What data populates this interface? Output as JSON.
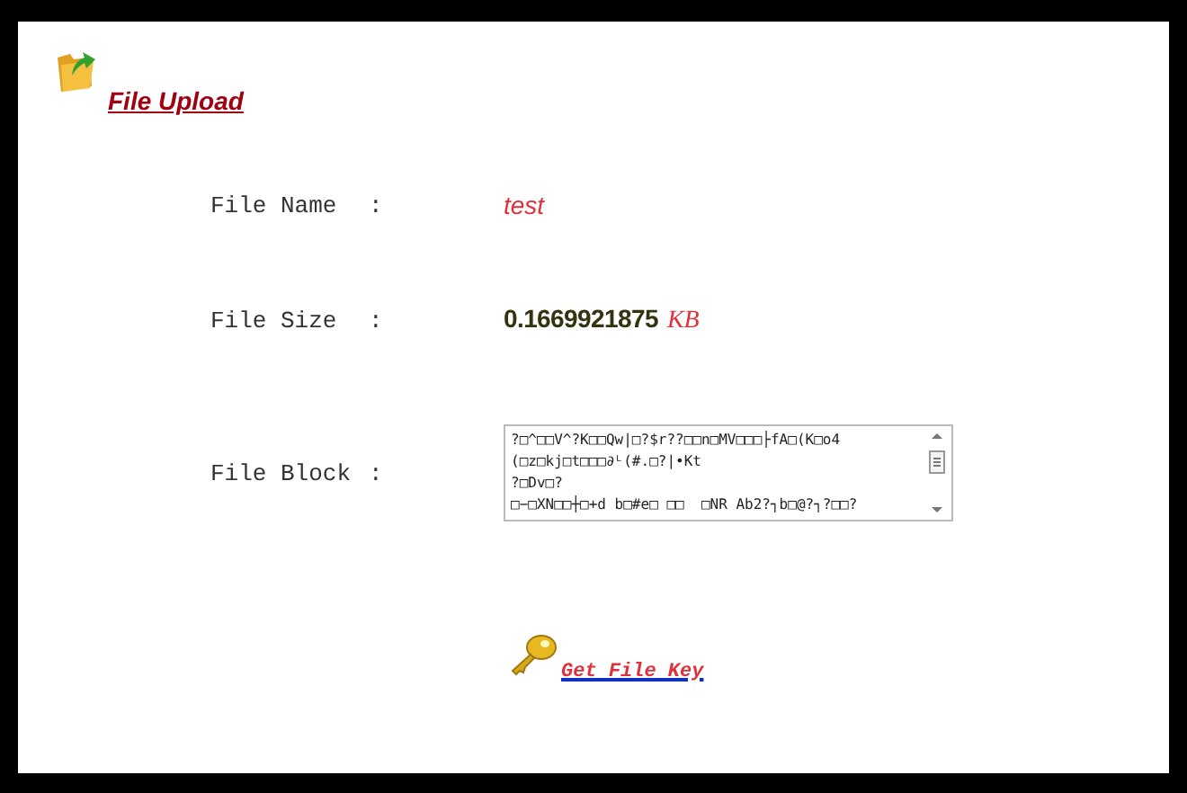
{
  "header": {
    "title": "File Upload"
  },
  "fields": [
    {
      "kind": "text",
      "label": "File Name",
      "colon": ":",
      "value": "test"
    },
    {
      "kind": "size",
      "label": "File Size",
      "colon": ":",
      "value": "0.1669921875",
      "unit": "KB"
    },
    {
      "kind": "block",
      "label": "File Block",
      "colon": ":",
      "lines": [
        "?□^□□V^?K□□Qw|□?$r??□□n□MV□□□├fA□(K□o4",
        "(□z□kj□t□□□∂ᴸ(#.□?|•Kt",
        "?□Dv□?",
        "□−□XN□□┼□+d b□#e□ □□  □NR Ab2?┐b□@?┐?□□?"
      ]
    }
  ],
  "action": {
    "label": "Get File Key"
  }
}
